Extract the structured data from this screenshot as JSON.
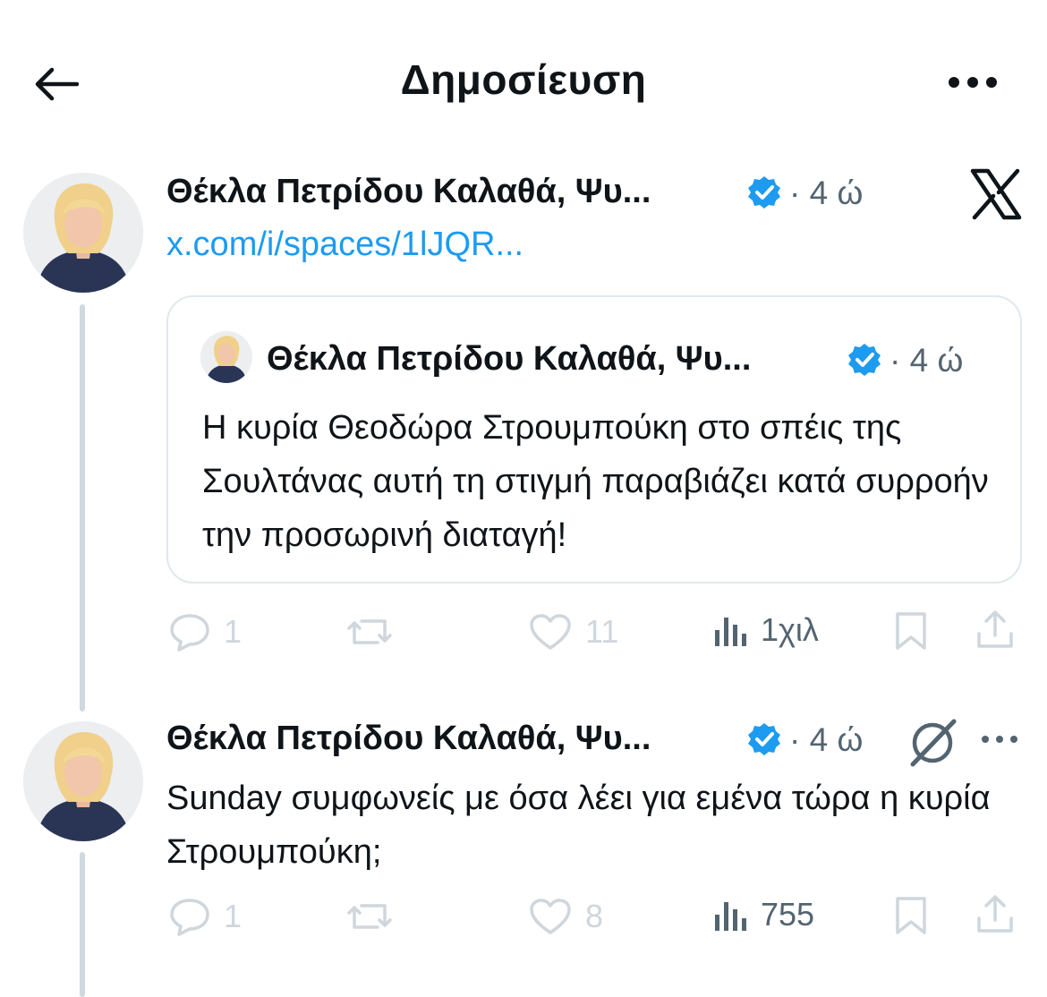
{
  "header": {
    "title": "Δημοσίευση"
  },
  "main_post": {
    "author_name": "Θέκλα Πετρίδου Καλαθά, Ψυ...",
    "time": "· 4 ώ",
    "link_text": "x.com/i/spaces/1lJQR...",
    "quote": {
      "author_name": "Θέκλα Πετρίδου Καλαθά, Ψυ...",
      "time": "· 4 ώ",
      "text": "Η κυρία Θεοδώρα Στρουμπούκη στο σπέις της Σουλτάνας αυτή τη στιγμή παραβιάζει κατά συρροήν την προσωρινή διαταγή!"
    },
    "actions": {
      "replies": "1",
      "likes": "11",
      "views": "1χιλ"
    }
  },
  "reply_post": {
    "author_name": "Θέκλα Πετρίδου Καλαθά, Ψυ...",
    "time": "· 4 ώ",
    "text": "Sunday συμφωνείς με όσα λέει για εμένα τώρα η κυρία Στρουμπούκη;",
    "actions": {
      "replies": "1",
      "likes": "8",
      "views": "755"
    }
  },
  "icons": {
    "back": "arrow-left-icon",
    "more": "more-dots-icon",
    "verified": "verified-badge-icon",
    "x_logo": "x-logo-icon",
    "grok": "grok-icon",
    "reply": "reply-icon",
    "repost": "repost-icon",
    "like": "heart-icon",
    "views": "views-icon",
    "bookmark": "bookmark-icon",
    "share": "share-icon"
  },
  "colors": {
    "accent": "#1d9bf0",
    "text": "#0f1419",
    "secondary": "#536471",
    "icon_muted": "#cfd6dc",
    "border": "#e1e8ed",
    "thread_line": "#cfd9de"
  }
}
